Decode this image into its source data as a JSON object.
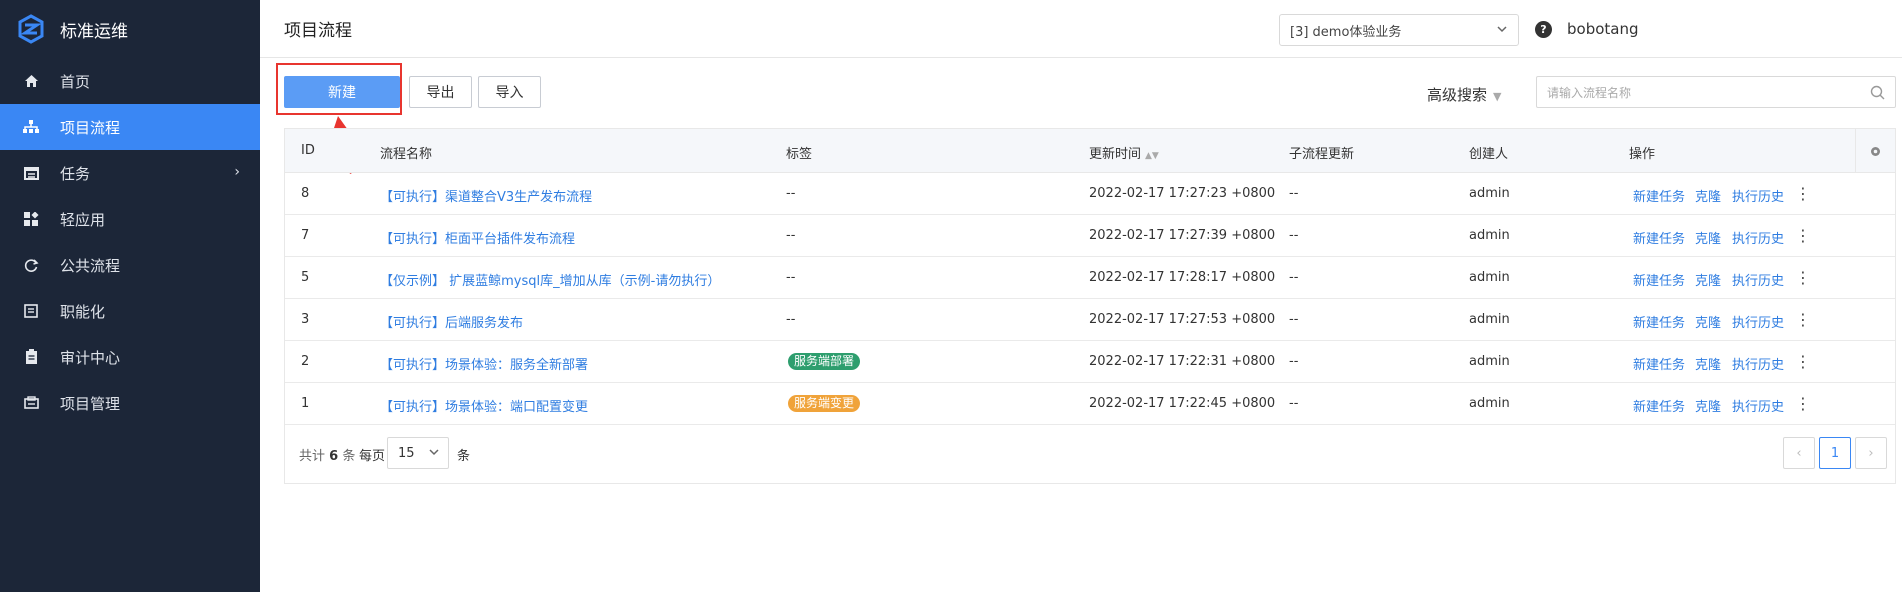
{
  "sidebar": {
    "brand": "标准运维",
    "items": [
      {
        "label": "首页",
        "icon": "home-icon"
      },
      {
        "label": "项目流程",
        "icon": "sitemap-icon",
        "active": true
      },
      {
        "label": "任务",
        "icon": "calendar-icon",
        "has_arrow": true
      },
      {
        "label": "轻应用",
        "icon": "apps-icon"
      },
      {
        "label": "公共流程",
        "icon": "refresh-icon"
      },
      {
        "label": "职能化",
        "icon": "function-icon"
      },
      {
        "label": "审计中心",
        "icon": "clipboard-icon"
      },
      {
        "label": "项目管理",
        "icon": "project-icon"
      }
    ]
  },
  "header": {
    "title": "项目流程",
    "business_select": "[3] demo体验业务",
    "help": "?",
    "user": "bobotang"
  },
  "toolbar": {
    "new_label": "新建",
    "export_label": "导出",
    "import_label": "导入",
    "advanced_search": "高级搜索",
    "search_placeholder": "请输入流程名称"
  },
  "table": {
    "columns": [
      "ID",
      "流程名称",
      "标签",
      "更新时间",
      "子流程更新",
      "创建人",
      "操作"
    ],
    "rows": [
      {
        "id": "8",
        "name": "【可执行】渠道整合V3生产发布流程",
        "tag": "--",
        "updated": "2022-02-17 17:27:23 +0800",
        "sub": "--",
        "creator": "admin"
      },
      {
        "id": "7",
        "name": "【可执行】柜面平台插件发布流程",
        "tag": "--",
        "updated": "2022-02-17 17:27:39 +0800",
        "sub": "--",
        "creator": "admin"
      },
      {
        "id": "5",
        "name": "【仅示例】 扩展蓝鲸mysql库_增加从库（示例-请勿执行）",
        "tag": "--",
        "updated": "2022-02-17 17:28:17 +0800",
        "sub": "--",
        "creator": "admin"
      },
      {
        "id": "3",
        "name": "【可执行】后端服务发布",
        "tag": "--",
        "updated": "2022-02-17 17:27:53 +0800",
        "sub": "--",
        "creator": "admin"
      },
      {
        "id": "2",
        "name": "【可执行】场景体验：服务全新部署",
        "tag": "服务端部署",
        "tag_color": "#2e9e6e",
        "updated": "2022-02-17 17:22:31 +0800",
        "sub": "--",
        "creator": "admin"
      },
      {
        "id": "1",
        "name": "【可执行】场景体验：端口配置变更",
        "tag": "服务端变更",
        "tag_color": "#f0a33a",
        "updated": "2022-02-17 17:22:45 +0800",
        "sub": "--",
        "creator": "admin"
      }
    ],
    "actions": [
      "新建任务",
      "克隆",
      "执行历史"
    ]
  },
  "pager": {
    "total_prefix": "共计",
    "total": "6",
    "total_suffix": "条",
    "per_page_label": "每页",
    "page_size": "15",
    "unit": "条",
    "current_page": "1"
  },
  "colors": {
    "sidebar_bg": "#1c2638",
    "accent": "#3a87f4",
    "link": "#2f7de1",
    "highlight": "#e8352f"
  }
}
